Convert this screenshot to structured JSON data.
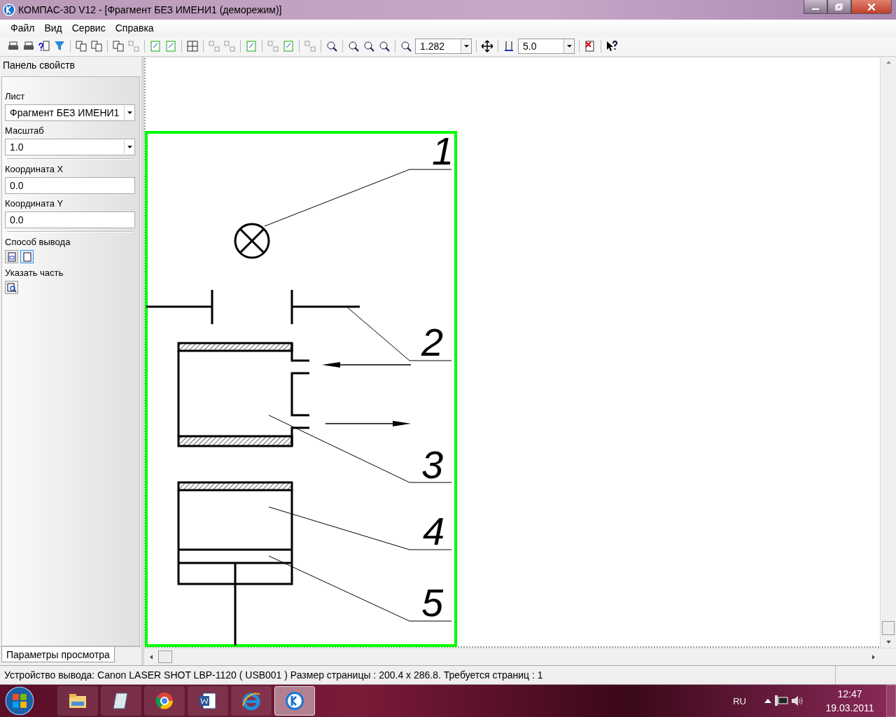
{
  "window": {
    "title": "КОМПАС-3D V12 - [Фрагмент БЕЗ ИМЕНИ1 (деморежим)]"
  },
  "menu": [
    "Файл",
    "Вид",
    "Сервис",
    "Справка"
  ],
  "toolbar": {
    "zoom_value": "1.282",
    "step_value": "5.0"
  },
  "properties_panel": {
    "title": "Панель свойств",
    "fields": [
      {
        "kind": "select",
        "label": "Лист",
        "value": "Фрагмент БЕЗ ИМЕНИ1"
      },
      {
        "kind": "select",
        "label": "Масштаб",
        "value": "1.0"
      },
      {
        "kind": "input",
        "label": "Координата X",
        "value": "0.0"
      },
      {
        "kind": "input",
        "label": "Координата Y",
        "value": "0.0"
      }
    ],
    "output_mode": {
      "label": "Способ вывода",
      "options": [
        {
          "selected": false
        },
        {
          "selected": true
        }
      ]
    },
    "select_part": {
      "label": "Указать часть"
    },
    "tab": "Параметры просмотра"
  },
  "drawing": {
    "callouts": [
      "1",
      "2",
      "3",
      "4",
      "5"
    ]
  },
  "status_bar": "Устройство вывода: Canon LASER SHOT LBP-1120 ( USB001 )  Размер страницы : 200.4 x 286.8.  Требуется страниц : 1",
  "taskbar": {
    "apps": [
      {
        "selected": false
      },
      {
        "selected": false
      },
      {
        "selected": false
      },
      {
        "selected": false
      },
      {
        "selected": false
      },
      {
        "selected": true
      }
    ],
    "language": "RU",
    "time": "12:47",
    "date": "19.03.2011"
  }
}
